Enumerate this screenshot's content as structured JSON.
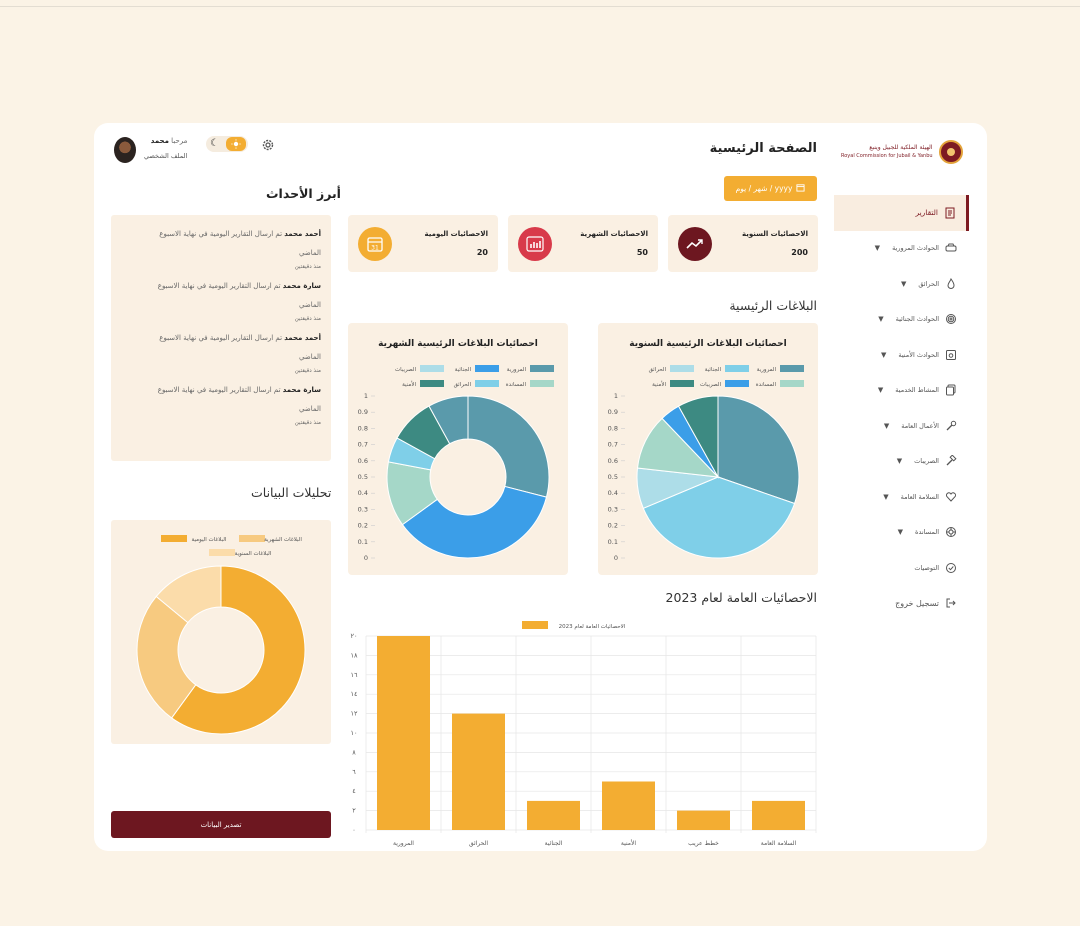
{
  "brand": {
    "name_ar": "الهيئة الملكية للجبيل وينبع",
    "name_en": "Royal Commission for Jubail & Yanbu"
  },
  "header": {
    "title": "الصفحة الرئيسية",
    "date_placeholder": "yyyy / شهر / يوم"
  },
  "user": {
    "greeting": "مرحبا",
    "name": "محمد",
    "profile": "الملف الشخصي"
  },
  "sidebar": {
    "items": [
      {
        "label": "التقارير",
        "icon": "report-icon",
        "active": true,
        "caret": false
      },
      {
        "label": "الحوادث المرورية",
        "icon": "car-icon",
        "caret": true
      },
      {
        "label": "الحرائق",
        "icon": "fire-icon",
        "caret": true
      },
      {
        "label": "الحوادث الجنائية",
        "icon": "fingerprint-icon",
        "caret": true
      },
      {
        "label": "الحوادث الأمنية",
        "icon": "security-icon",
        "caret": true
      },
      {
        "label": "المشاط الخدمية",
        "icon": "copy-icon",
        "caret": true
      },
      {
        "label": "الأعمال العامة",
        "icon": "wrench-icon",
        "caret": true
      },
      {
        "label": "الصريبات",
        "icon": "hammer-icon",
        "caret": true
      },
      {
        "label": "السلامة العامة",
        "icon": "heart-icon",
        "caret": true
      },
      {
        "label": "المساندة",
        "icon": "lifebuoy-icon",
        "caret": true
      },
      {
        "label": "التوصيات",
        "icon": "check-circle-icon",
        "caret": false
      }
    ],
    "logout": "تسجيل خروج"
  },
  "stats": [
    {
      "title": "الاحصائيات السنوية",
      "value": "200",
      "color": "#6d1720",
      "icon": "trend-icon"
    },
    {
      "title": "الاحصائيات الشهرية",
      "value": "50",
      "color": "#d83a4a",
      "icon": "bar-chart-icon"
    },
    {
      "title": "الاحصائيات اليومية",
      "value": "20",
      "color": "#f3ad32",
      "icon": "calendar-icon"
    }
  ],
  "sections": {
    "main_reports": "البلاغات الرئيسية",
    "general_stats": "الاحصائيات العامة لعام 2023",
    "events": "أبرز الأحداث",
    "analysis": "تحليلات البيانات"
  },
  "events": [
    {
      "name": "أحمد محمد",
      "text": "تم ارسال التقارير اليومية في نهاية الاسبوع",
      "text2": "الماضي",
      "time": "منذ دقيقتين"
    },
    {
      "name": "سارة محمد",
      "text": "تم ارسال التقارير اليومية في نهاية الاسبوع",
      "text2": "الماضي",
      "time": "منذ دقيقتين"
    },
    {
      "name": "أحمد محمد",
      "text": "تم ارسال التقارير اليومية في نهاية الاسبوع",
      "text2": "الماضي",
      "time": "منذ دقيقتين"
    },
    {
      "name": "سارة محمد",
      "text": "تم ارسال التقارير اليومية في نهاية الاسبوع",
      "text2": "الماضي",
      "time": "منذ دقيقتين"
    }
  ],
  "export_label": "تصدير البيانات",
  "chart_data": [
    {
      "type": "pie",
      "title": "احصائيات البلاغات الرئيسية السنوية",
      "legend": [
        "المرورية",
        "الجنائية",
        "الحرائق",
        "المساندة",
        "الصريبات",
        "الأمنية"
      ],
      "colors": [
        "#5a9aab",
        "#7fcfe8",
        "#addde8",
        "#a5d7c8",
        "#3b9ee8",
        "#3d8a82"
      ],
      "values": [
        30,
        38,
        8,
        11,
        4,
        8
      ],
      "ylim": [
        0,
        1
      ],
      "yticks": [
        "1",
        "0.9",
        "0.8",
        "0.7",
        "0.6",
        "0.5",
        "0.4",
        "0.3",
        "0.2",
        "0.1",
        "0"
      ]
    },
    {
      "type": "pie",
      "title": "احصائيات البلاغات الرئيسية الشهرية",
      "legend": [
        "المرورية",
        "الجنائية",
        "الصريبات",
        "المساندة",
        "الحرائق",
        "الأمنية"
      ],
      "colors": [
        "#5a9aab",
        "#3b9ee8",
        "#addde8",
        "#a5d7c8",
        "#7fcfe8",
        "#3d8a82"
      ],
      "values": [
        29,
        36,
        0,
        13,
        5,
        9,
        8
      ],
      "ylim": [
        0,
        1
      ],
      "yticks": [
        "1",
        "0.9",
        "0.8",
        "0.7",
        "0.6",
        "0.5",
        "0.4",
        "0.3",
        "0.2",
        "0.1",
        "0"
      ]
    },
    {
      "type": "bar",
      "title": "",
      "series": [
        {
          "name": "الاحصائيات العامة لعام 2023",
          "color": "#f3ad32",
          "values": [
            20,
            12,
            3,
            5,
            2,
            3
          ]
        }
      ],
      "categories": [
        "المرورية",
        "الحرائق",
        "الجنائية",
        "الأمنية",
        "خطط عريب",
        "السلامة العامة"
      ],
      "ylim": [
        0,
        20
      ],
      "yticks": [
        "٠",
        "٢",
        "٤",
        "٦",
        "٨",
        "١٠",
        "١٢",
        "١٤",
        "١٦",
        "١٨",
        "٢٠"
      ]
    },
    {
      "type": "pie",
      "title": "",
      "legend": [
        "البلاغات اليومية",
        "البلاغات الشهرية",
        "البلاغات السنوية"
      ],
      "colors": [
        "#f3ad32",
        "#f7ca80",
        "#fbdcaa"
      ],
      "values": [
        60,
        26,
        14
      ]
    }
  ]
}
